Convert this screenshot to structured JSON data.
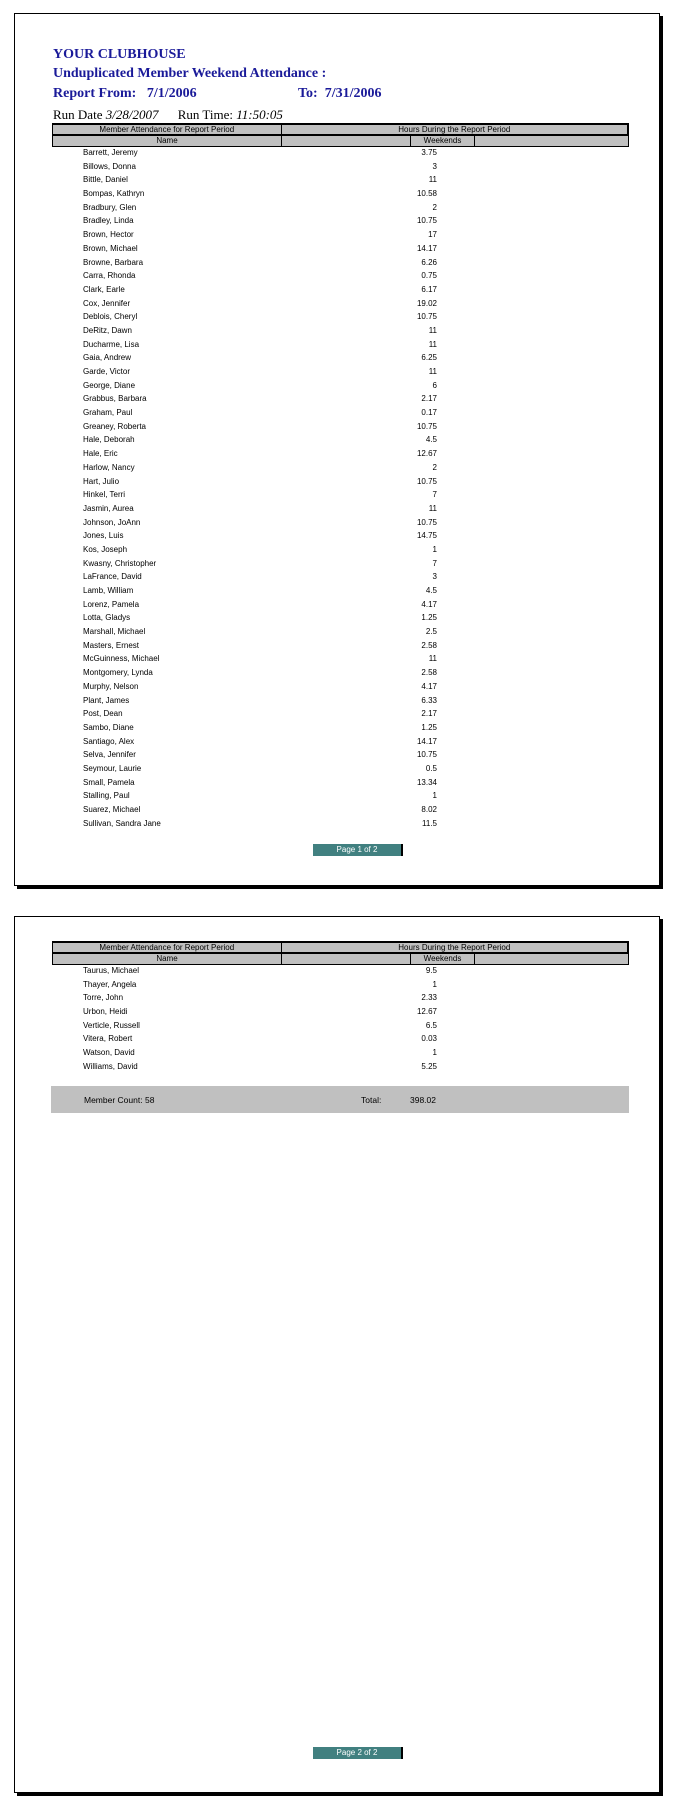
{
  "report": {
    "org": "YOUR CLUBHOUSE",
    "title": "Unduplicated Member Weekend Attendance :",
    "from_label": "Report From:",
    "from_date": "7/1/2006",
    "to_label": "To:",
    "to_date": "7/31/2006",
    "run_date_label": "Run Date",
    "run_date": "3/28/2007",
    "run_time_label": "Run Time:",
    "run_time": "11:50:05"
  },
  "table_header": {
    "group_left": "Member Attendance for Report Period",
    "group_right": "Hours During the Report Period",
    "col_name": "Name",
    "col_weekends": "Weekends"
  },
  "page1_rows": [
    {
      "name": "Barrett, Jeremy",
      "weekends": "3.75"
    },
    {
      "name": "Billows, Donna",
      "weekends": "3"
    },
    {
      "name": "Bittle, Daniel",
      "weekends": "11"
    },
    {
      "name": "Bompas, Kathryn",
      "weekends": "10.58"
    },
    {
      "name": "Bradbury, Glen",
      "weekends": "2"
    },
    {
      "name": "Bradley, Linda",
      "weekends": "10.75"
    },
    {
      "name": "Brown, Hector",
      "weekends": "17"
    },
    {
      "name": "Brown, Michael",
      "weekends": "14.17"
    },
    {
      "name": "Browne, Barbara",
      "weekends": "6.26"
    },
    {
      "name": "Carra, Rhonda",
      "weekends": "0.75"
    },
    {
      "name": "Clark, Earle",
      "weekends": "6.17"
    },
    {
      "name": "Cox, Jennifer",
      "weekends": "19.02"
    },
    {
      "name": "Deblois, Cheryl",
      "weekends": "10.75"
    },
    {
      "name": "DeRitz, Dawn",
      "weekends": "11"
    },
    {
      "name": "Ducharme, Lisa",
      "weekends": "11"
    },
    {
      "name": "Gaia, Andrew",
      "weekends": "6.25"
    },
    {
      "name": "Garde, Victor",
      "weekends": "11"
    },
    {
      "name": "George, Diane",
      "weekends": "6"
    },
    {
      "name": "Grabbus, Barbara",
      "weekends": "2.17"
    },
    {
      "name": "Graham, Paul",
      "weekends": "0.17"
    },
    {
      "name": "Greaney, Roberta",
      "weekends": "10.75"
    },
    {
      "name": "Hale, Deborah",
      "weekends": "4.5"
    },
    {
      "name": "Hale, Eric",
      "weekends": "12.67"
    },
    {
      "name": "Harlow, Nancy",
      "weekends": "2"
    },
    {
      "name": "Hart, Julio",
      "weekends": "10.75"
    },
    {
      "name": "Hinkel, Terri",
      "weekends": "7"
    },
    {
      "name": "Jasmin, Aurea",
      "weekends": "11"
    },
    {
      "name": "Johnson, JoAnn",
      "weekends": "10.75"
    },
    {
      "name": "Jones, Luis",
      "weekends": "14.75"
    },
    {
      "name": "Kos, Joseph",
      "weekends": "1"
    },
    {
      "name": "Kwasny, Christopher",
      "weekends": "7"
    },
    {
      "name": "LaFrance, David",
      "weekends": "3"
    },
    {
      "name": "Lamb, William",
      "weekends": "4.5"
    },
    {
      "name": "Lorenz, Pamela",
      "weekends": "4.17"
    },
    {
      "name": "Lotta, Gladys",
      "weekends": "1.25"
    },
    {
      "name": "Marshall, Michael",
      "weekends": "2.5"
    },
    {
      "name": "Masters, Ernest",
      "weekends": "2.58"
    },
    {
      "name": "McGuinness, Michael",
      "weekends": "11"
    },
    {
      "name": "Montgomery, Lynda",
      "weekends": "2.58"
    },
    {
      "name": "Murphy, Nelson",
      "weekends": "4.17"
    },
    {
      "name": "Plant, James",
      "weekends": "6.33"
    },
    {
      "name": "Post, Dean",
      "weekends": "2.17"
    },
    {
      "name": "Sambo, Diane",
      "weekends": "1.25"
    },
    {
      "name": "Santiago, Alex",
      "weekends": "14.17"
    },
    {
      "name": "Selva, Jennifer",
      "weekends": "10.75"
    },
    {
      "name": "Seymour, Laurie",
      "weekends": "0.5"
    },
    {
      "name": "Small, Pamela",
      "weekends": "13.34"
    },
    {
      "name": "Stalling, Paul",
      "weekends": "1"
    },
    {
      "name": "Suarez, Michael",
      "weekends": "8.02"
    },
    {
      "name": "Sullivan, Sandra Jane",
      "weekends": "11.5"
    }
  ],
  "page2_rows": [
    {
      "name": "Taurus, Michael",
      "weekends": "9.5"
    },
    {
      "name": "Thayer, Angela",
      "weekends": "1"
    },
    {
      "name": "Torre, John",
      "weekends": "2.33"
    },
    {
      "name": "Urbon, Heidi",
      "weekends": "12.67"
    },
    {
      "name": "Verticle, Russell",
      "weekends": "6.5"
    },
    {
      "name": "Vitera, Robert",
      "weekends": "0.03"
    },
    {
      "name": "Watson, David",
      "weekends": "1"
    },
    {
      "name": "Williams, David",
      "weekends": "5.25"
    }
  ],
  "summary": {
    "member_count_label": "Member Count:",
    "member_count": "58",
    "total_label": "Total:",
    "total": "398.02"
  },
  "pages": {
    "page1": "Page 1 of 2",
    "page2": "Page 2 of 2"
  },
  "colors": {
    "title": "#1a1a99",
    "header_bg": "#c0c0c0",
    "pager_bg": "#418080"
  }
}
